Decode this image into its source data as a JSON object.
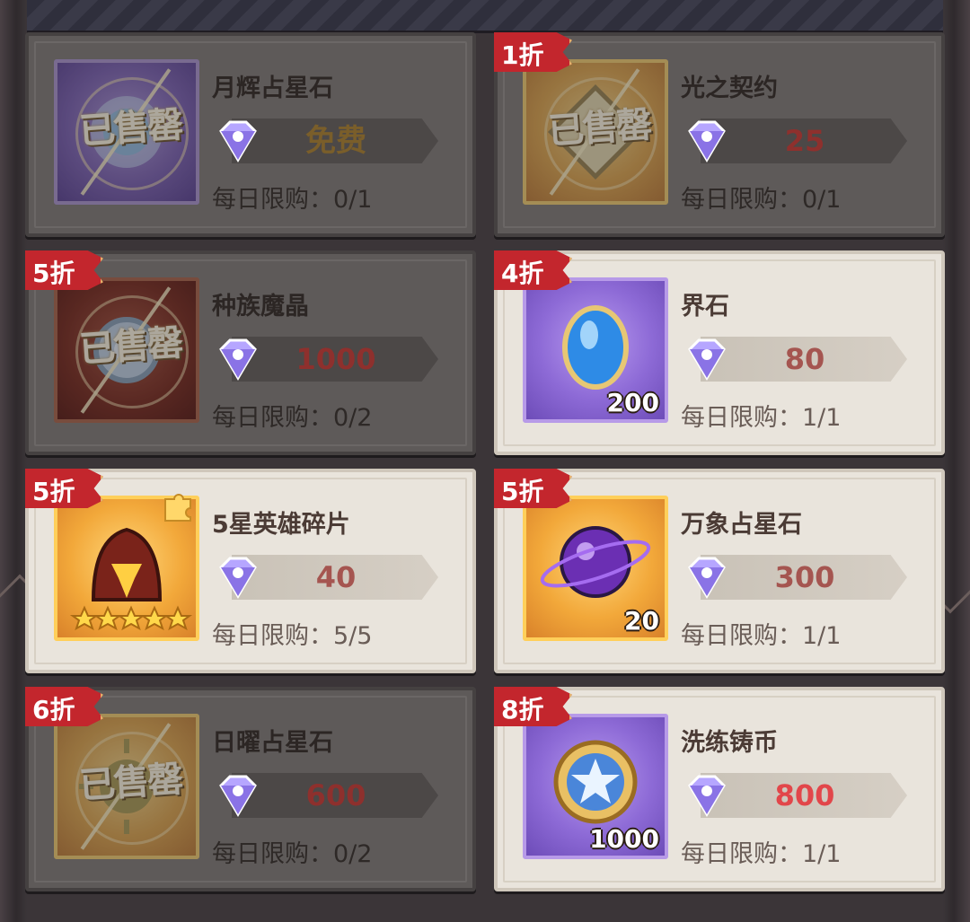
{
  "items": [
    {
      "name": "月辉占星石",
      "price": "免费",
      "limit": "每日限购：0/1",
      "sold_out": true,
      "stamp": "已售罄",
      "icon": "moon-star-stone-icon",
      "theme": "purple"
    },
    {
      "name": "光之契约",
      "price": "25",
      "limit": "每日限购：0/1",
      "sold_out": true,
      "stamp": "已售罄",
      "badge": "1折",
      "icon": "light-contract-icon",
      "theme": "gold"
    },
    {
      "name": "种族魔晶",
      "price": "1000",
      "limit": "每日限购：0/2",
      "sold_out": true,
      "stamp": "已售罄",
      "badge": "5折",
      "icon": "race-crystal-icon",
      "theme": "red"
    },
    {
      "name": "界石",
      "price": "80",
      "limit": "每日限购：1/1",
      "sold_out": false,
      "badge": "4折",
      "qty": "200",
      "icon": "realm-stone-icon",
      "theme": "purple"
    },
    {
      "name": "5星英雄碎片",
      "price": "40",
      "limit": "每日限购：5/5",
      "sold_out": false,
      "badge": "5折",
      "icon": "hero-helmet-icon",
      "theme": "gold",
      "stars": 5
    },
    {
      "name": "万象占星石",
      "price": "300",
      "limit": "每日限购：1/1",
      "sold_out": false,
      "badge": "5折",
      "qty": "20",
      "icon": "cosmic-orb-icon",
      "theme": "gold"
    },
    {
      "name": "日曜占星石",
      "price": "600",
      "limit": "每日限购：0/2",
      "sold_out": true,
      "stamp": "已售罄",
      "badge": "6折",
      "icon": "sun-star-stone-icon",
      "theme": "gold"
    },
    {
      "name": "洗练铸币",
      "price": "800",
      "limit": "每日限购：1/1",
      "sold_out": false,
      "badge": "8折",
      "qty": "1000",
      "icon": "star-coin-icon",
      "theme": "purple"
    }
  ],
  "colors": {
    "badge": "#c3262d",
    "price": "#a55550",
    "price_hot": "#e2464a"
  }
}
